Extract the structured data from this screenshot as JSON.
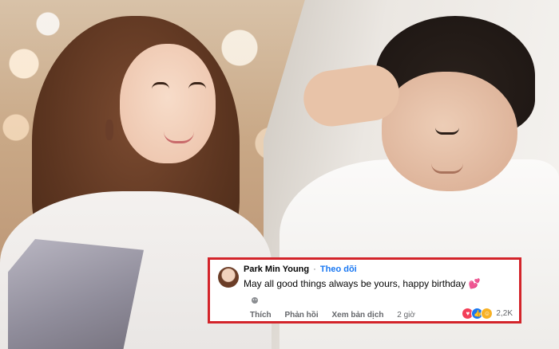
{
  "comment": {
    "author": "Park Min Young",
    "separator": "·",
    "follow_label": "Theo dõi",
    "text": "May all good things always be yours, happy birthday",
    "emoji": "💕",
    "actions": {
      "like": "Thích",
      "reply": "Phản hồi",
      "translate": "Xem bản dịch",
      "time": "2 giờ"
    },
    "reaction_count": "2,2K",
    "reactions": [
      "love-icon",
      "like-icon",
      "care-icon"
    ],
    "highlight_color": "#d3242a",
    "follow_color": "#1877f2"
  }
}
